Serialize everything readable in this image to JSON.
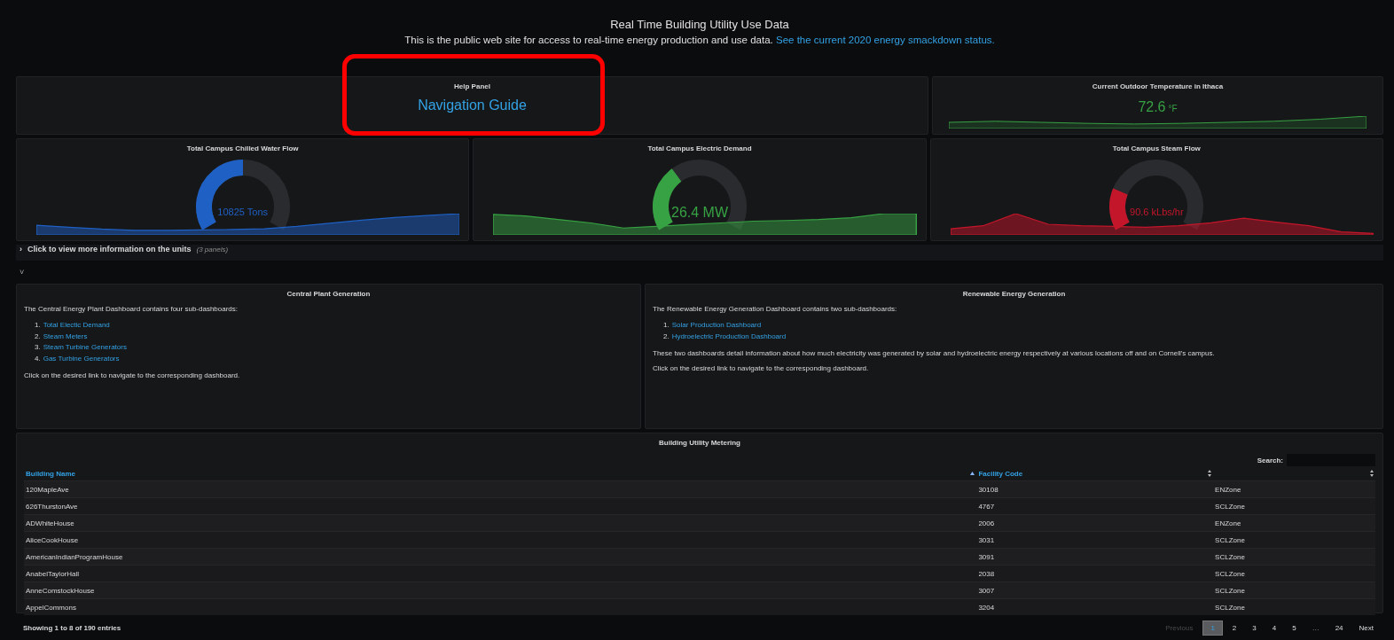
{
  "header": {
    "title": "Real Time Building Utility Use Data",
    "text": "This is the public web site for access to real-time energy production and use data.",
    "link": "See the current 2020 energy smackdown status."
  },
  "help_panel": {
    "title": "Help Panel",
    "link": "Navigation Guide",
    "highlighted": true
  },
  "temperature_panel": {
    "title": "Current Outdoor Temperature in Ithaca",
    "value": "72.6",
    "unit": "°F"
  },
  "gauges": [
    {
      "title": "Total Campus Chilled Water Flow",
      "value": "10825 Tons",
      "color": "#1f60c4"
    },
    {
      "title": "Total Campus Electric Demand",
      "value": "26.4 MW",
      "color": "#37a243"
    },
    {
      "title": "Total Campus Steam Flow",
      "value": "90.6 kLbs/hr",
      "color": "#c4162a"
    }
  ],
  "collapsed_row": {
    "arrow": "›",
    "title": "Click to view more information on the units",
    "count": "(3 panels)"
  },
  "row_toggle": "˅",
  "text_panels": [
    {
      "title": "Central Plant Generation",
      "intro": "The Central Energy Plant Dashboard contains four sub-dashboards:",
      "links": [
        {
          "number": "1.",
          "label": "Total Electic Demand"
        },
        {
          "number": "2.",
          "label": "Steam Meters"
        },
        {
          "number": "3.",
          "label": "Steam Turbine Generators"
        },
        {
          "number": "4.",
          "label": "Gas Turbine Generators"
        }
      ],
      "paragraphs": [
        "Click on the desired link to navigate to the corresponding dashboard."
      ]
    },
    {
      "title": "Renewable Energy Generation",
      "intro": "The Renewable Energy Generation Dashboard contains two sub-dashboards:",
      "links": [
        {
          "number": "1.",
          "label": "Solar Production Dashboard"
        },
        {
          "number": "2.",
          "label": "Hydroelectric Production Dashboard"
        }
      ],
      "paragraphs": [
        "These two dashboards detail information about how much electricity was generated by solar and hydroelectric energy respectively at various locations off and on Cornell's campus.",
        "Click on the desired link to navigate to the corresponding dashboard."
      ]
    }
  ],
  "table": {
    "title": "Building Utility Metering",
    "search_label": "Search:",
    "columns": [
      "Building Name",
      "Facility Code"
    ],
    "rows": [
      [
        "120MapleAve",
        "30108",
        "ENZone"
      ],
      [
        "626ThurstonAve",
        "4767",
        "SCLZone"
      ],
      [
        "ADWhiteHouse",
        "2006",
        "ENZone"
      ],
      [
        "AliceCookHouse",
        "3031",
        "SCLZone"
      ],
      [
        "AmericanIndianProgramHouse",
        "3091",
        "SCLZone"
      ],
      [
        "AnabelTaylorHall",
        "2038",
        "SCLZone"
      ],
      [
        "AnneComstockHouse",
        "3007",
        "SCLZone"
      ],
      [
        "AppelCommons",
        "3204",
        "SCLZone"
      ]
    ],
    "info": "Showing 1 to 8 of 190 entries",
    "pagination": [
      {
        "label": "Previous",
        "kind": "nav",
        "disabled": true,
        "selected": false
      },
      {
        "label": "1",
        "kind": "page",
        "disabled": false,
        "selected": true
      },
      {
        "label": "2",
        "kind": "page",
        "disabled": false,
        "selected": false
      },
      {
        "label": "3",
        "kind": "page",
        "disabled": false,
        "selected": false
      },
      {
        "label": "4",
        "kind": "page",
        "disabled": false,
        "selected": false
      },
      {
        "label": "5",
        "kind": "page",
        "disabled": false,
        "selected": false
      },
      {
        "label": "…",
        "kind": "ellipsis"
      },
      {
        "label": "24",
        "kind": "page",
        "disabled": false,
        "selected": false
      },
      {
        "label": "Next",
        "kind": "nav",
        "disabled": false,
        "selected": false
      }
    ]
  }
}
